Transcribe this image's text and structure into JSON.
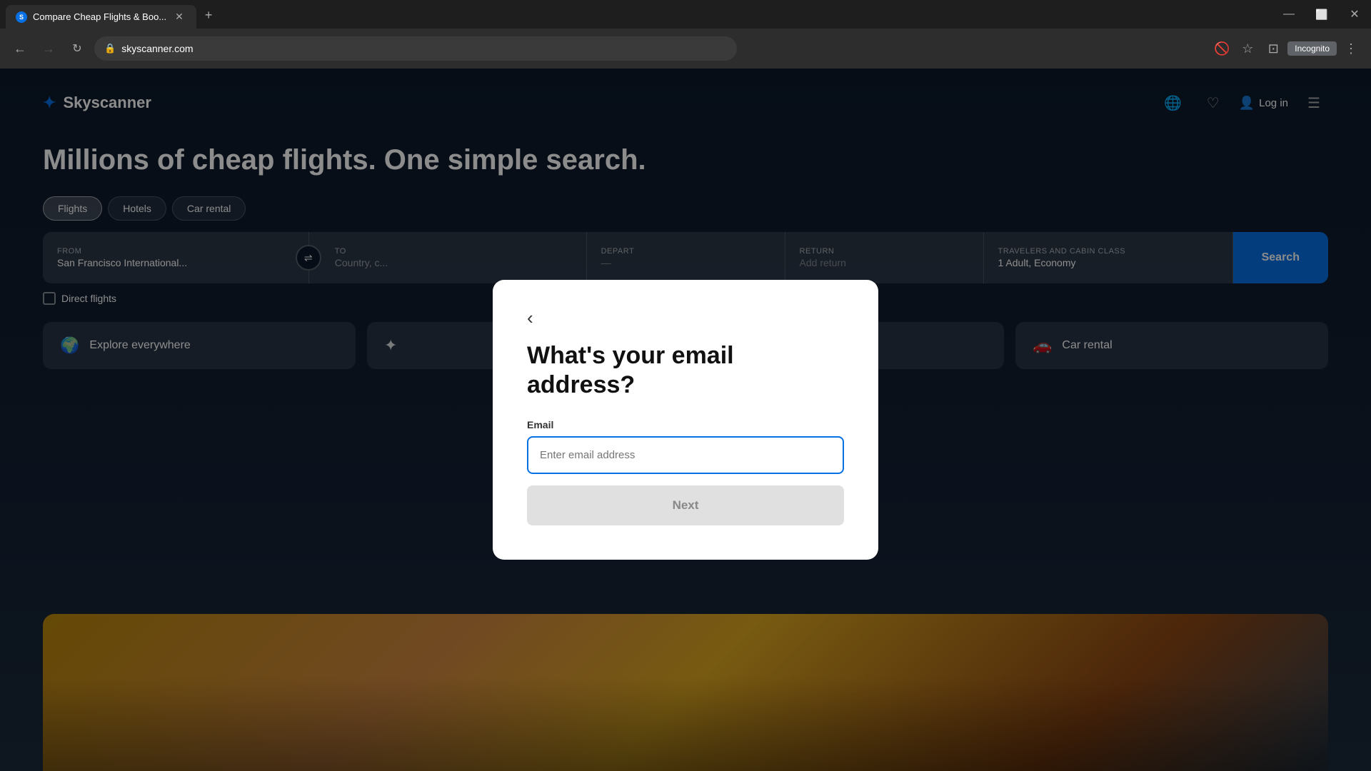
{
  "browser": {
    "tab_title": "Compare Cheap Flights & Boo...",
    "url": "skyscanner.com",
    "new_tab_label": "+",
    "incognito_label": "Incognito"
  },
  "header": {
    "logo_name": "Skyscanner",
    "nav_items": [
      "Log in"
    ],
    "globe_icon": "🌐",
    "heart_icon": "♡",
    "user_icon": "👤",
    "menu_icon": "☰"
  },
  "hero": {
    "title": "Millions of cheap flights. One simple search.",
    "tabs": [
      "Flights",
      "Hotels",
      "Car rental"
    ],
    "active_tab": "Flights"
  },
  "search": {
    "from_label": "From",
    "from_value": "San Francisco International...",
    "to_label": "To",
    "to_placeholder": "Country, c...",
    "travelers_label": "Travelers and cabin class",
    "travelers_value": "1 Adult, Economy",
    "search_button": "Search",
    "direct_flights_label": "Direct flights"
  },
  "quick_links": [
    {
      "icon": "🌍",
      "label": "Explore everywhere"
    },
    {
      "icon": "✦",
      "label": ""
    },
    {
      "icon": "",
      "label": ""
    },
    {
      "icon": "🚗",
      "label": "Car rental"
    }
  ],
  "modal": {
    "back_icon": "‹",
    "title": "What's your email address?",
    "email_label": "Email",
    "email_placeholder": "Enter email address",
    "next_button": "Next"
  }
}
